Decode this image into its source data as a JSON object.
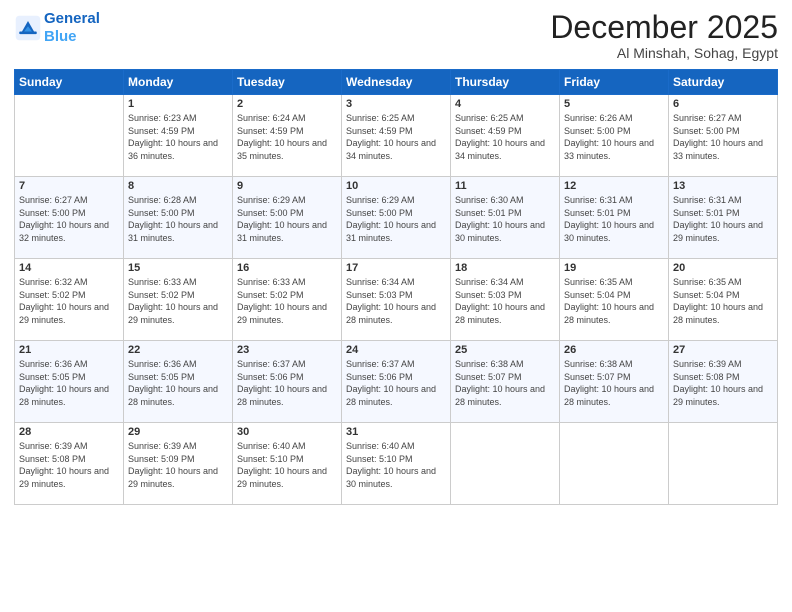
{
  "logo": {
    "line1": "General",
    "line2": "Blue"
  },
  "title": "December 2025",
  "subtitle": "Al Minshah, Sohag, Egypt",
  "days_of_week": [
    "Sunday",
    "Monday",
    "Tuesday",
    "Wednesday",
    "Thursday",
    "Friday",
    "Saturday"
  ],
  "weeks": [
    [
      {
        "num": "",
        "info": ""
      },
      {
        "num": "1",
        "info": "Sunrise: 6:23 AM\nSunset: 4:59 PM\nDaylight: 10 hours\nand 36 minutes."
      },
      {
        "num": "2",
        "info": "Sunrise: 6:24 AM\nSunset: 4:59 PM\nDaylight: 10 hours\nand 35 minutes."
      },
      {
        "num": "3",
        "info": "Sunrise: 6:25 AM\nSunset: 4:59 PM\nDaylight: 10 hours\nand 34 minutes."
      },
      {
        "num": "4",
        "info": "Sunrise: 6:25 AM\nSunset: 4:59 PM\nDaylight: 10 hours\nand 34 minutes."
      },
      {
        "num": "5",
        "info": "Sunrise: 6:26 AM\nSunset: 5:00 PM\nDaylight: 10 hours\nand 33 minutes."
      },
      {
        "num": "6",
        "info": "Sunrise: 6:27 AM\nSunset: 5:00 PM\nDaylight: 10 hours\nand 33 minutes."
      }
    ],
    [
      {
        "num": "7",
        "info": "Sunrise: 6:27 AM\nSunset: 5:00 PM\nDaylight: 10 hours\nand 32 minutes."
      },
      {
        "num": "8",
        "info": "Sunrise: 6:28 AM\nSunset: 5:00 PM\nDaylight: 10 hours\nand 31 minutes."
      },
      {
        "num": "9",
        "info": "Sunrise: 6:29 AM\nSunset: 5:00 PM\nDaylight: 10 hours\nand 31 minutes."
      },
      {
        "num": "10",
        "info": "Sunrise: 6:29 AM\nSunset: 5:00 PM\nDaylight: 10 hours\nand 31 minutes."
      },
      {
        "num": "11",
        "info": "Sunrise: 6:30 AM\nSunset: 5:01 PM\nDaylight: 10 hours\nand 30 minutes."
      },
      {
        "num": "12",
        "info": "Sunrise: 6:31 AM\nSunset: 5:01 PM\nDaylight: 10 hours\nand 30 minutes."
      },
      {
        "num": "13",
        "info": "Sunrise: 6:31 AM\nSunset: 5:01 PM\nDaylight: 10 hours\nand 29 minutes."
      }
    ],
    [
      {
        "num": "14",
        "info": "Sunrise: 6:32 AM\nSunset: 5:02 PM\nDaylight: 10 hours\nand 29 minutes."
      },
      {
        "num": "15",
        "info": "Sunrise: 6:33 AM\nSunset: 5:02 PM\nDaylight: 10 hours\nand 29 minutes."
      },
      {
        "num": "16",
        "info": "Sunrise: 6:33 AM\nSunset: 5:02 PM\nDaylight: 10 hours\nand 29 minutes."
      },
      {
        "num": "17",
        "info": "Sunrise: 6:34 AM\nSunset: 5:03 PM\nDaylight: 10 hours\nand 28 minutes."
      },
      {
        "num": "18",
        "info": "Sunrise: 6:34 AM\nSunset: 5:03 PM\nDaylight: 10 hours\nand 28 minutes."
      },
      {
        "num": "19",
        "info": "Sunrise: 6:35 AM\nSunset: 5:04 PM\nDaylight: 10 hours\nand 28 minutes."
      },
      {
        "num": "20",
        "info": "Sunrise: 6:35 AM\nSunset: 5:04 PM\nDaylight: 10 hours\nand 28 minutes."
      }
    ],
    [
      {
        "num": "21",
        "info": "Sunrise: 6:36 AM\nSunset: 5:05 PM\nDaylight: 10 hours\nand 28 minutes."
      },
      {
        "num": "22",
        "info": "Sunrise: 6:36 AM\nSunset: 5:05 PM\nDaylight: 10 hours\nand 28 minutes."
      },
      {
        "num": "23",
        "info": "Sunrise: 6:37 AM\nSunset: 5:06 PM\nDaylight: 10 hours\nand 28 minutes."
      },
      {
        "num": "24",
        "info": "Sunrise: 6:37 AM\nSunset: 5:06 PM\nDaylight: 10 hours\nand 28 minutes."
      },
      {
        "num": "25",
        "info": "Sunrise: 6:38 AM\nSunset: 5:07 PM\nDaylight: 10 hours\nand 28 minutes."
      },
      {
        "num": "26",
        "info": "Sunrise: 6:38 AM\nSunset: 5:07 PM\nDaylight: 10 hours\nand 28 minutes."
      },
      {
        "num": "27",
        "info": "Sunrise: 6:39 AM\nSunset: 5:08 PM\nDaylight: 10 hours\nand 29 minutes."
      }
    ],
    [
      {
        "num": "28",
        "info": "Sunrise: 6:39 AM\nSunset: 5:08 PM\nDaylight: 10 hours\nand 29 minutes."
      },
      {
        "num": "29",
        "info": "Sunrise: 6:39 AM\nSunset: 5:09 PM\nDaylight: 10 hours\nand 29 minutes."
      },
      {
        "num": "30",
        "info": "Sunrise: 6:40 AM\nSunset: 5:10 PM\nDaylight: 10 hours\nand 29 minutes."
      },
      {
        "num": "31",
        "info": "Sunrise: 6:40 AM\nSunset: 5:10 PM\nDaylight: 10 hours\nand 30 minutes."
      },
      {
        "num": "",
        "info": ""
      },
      {
        "num": "",
        "info": ""
      },
      {
        "num": "",
        "info": ""
      }
    ]
  ]
}
